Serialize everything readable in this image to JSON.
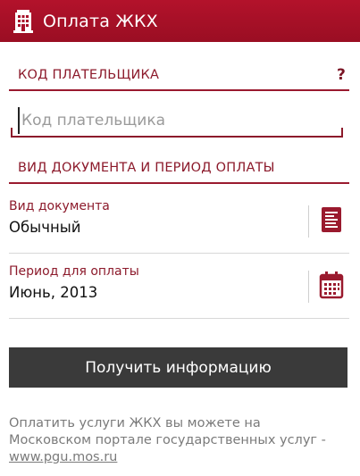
{
  "app": {
    "title": "Оплата ЖКХ"
  },
  "payer_section": {
    "header": "КОД ПЛАТЕЛЬЩИКА",
    "help": "?"
  },
  "payer_input": {
    "placeholder": "Код плательщика",
    "value": ""
  },
  "doc_section": {
    "header": "ВИД ДОКУМЕНТА И ПЕРИОД ОПЛАТЫ"
  },
  "doc_type": {
    "label": "Вид документа",
    "value": "Обычный",
    "icon": "document-list-icon"
  },
  "period": {
    "label": "Период для оплаты",
    "value": "Июнь, 2013",
    "icon": "calendar-icon"
  },
  "submit": {
    "label": "Получить информацию"
  },
  "info": {
    "line1": "Оплатить услуги ЖКХ вы можете на",
    "line2": "Московском портале государственных услуг -",
    "link": "www.pgu.mos.ru"
  },
  "colors": {
    "brand": "#9a0e23",
    "accent": "#8c1a2b",
    "button": "#3a3a3a"
  }
}
